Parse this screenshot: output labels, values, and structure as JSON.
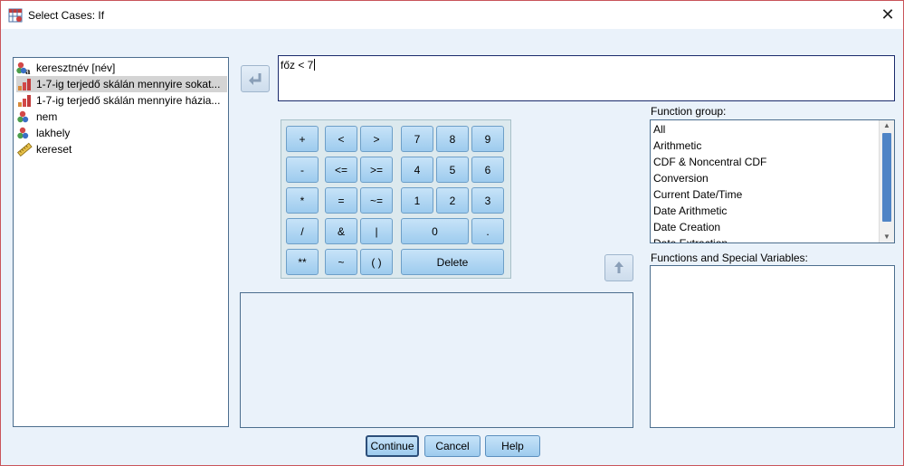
{
  "window": {
    "title": "Select Cases: If"
  },
  "variables": [
    {
      "label": "keresztnév [név]",
      "icon": "nominal-string-icon",
      "selected": false
    },
    {
      "label": "1-7-ig terjedő skálán mennyire sokat...",
      "icon": "ordinal-icon",
      "selected": true
    },
    {
      "label": "1-7-ig terjedő skálán mennyire házia...",
      "icon": "ordinal-icon",
      "selected": false
    },
    {
      "label": "nem",
      "icon": "nominal-icon",
      "selected": false
    },
    {
      "label": "lakhely",
      "icon": "nominal-icon",
      "selected": false
    },
    {
      "label": "kereset",
      "icon": "scale-ruler-icon",
      "selected": false
    }
  ],
  "expression": {
    "value": "főz < 7"
  },
  "keypad": {
    "plus": "+",
    "lt": "<",
    "gt": ">",
    "k7": "7",
    "k8": "8",
    "k9": "9",
    "minus": "-",
    "le": "<=",
    "ge": ">=",
    "k4": "4",
    "k5": "5",
    "k6": "6",
    "mult": "*",
    "eq": "=",
    "ne": "~=",
    "k1": "1",
    "k2": "2",
    "k3": "3",
    "div": "/",
    "and": "&",
    "or": "|",
    "k0": "0",
    "dot": ".",
    "pow": "**",
    "not": "~",
    "paren": "( )",
    "delete": "Delete"
  },
  "function_group": {
    "label": "Function group:",
    "items": [
      "All",
      "Arithmetic",
      "CDF & Noncentral CDF",
      "Conversion",
      "Current Date/Time",
      "Date Arithmetic",
      "Date Creation",
      "Date Extraction"
    ]
  },
  "functions": {
    "label": "Functions and Special Variables:"
  },
  "buttons": {
    "continue": "Continue",
    "cancel": "Cancel",
    "help": "Help"
  }
}
